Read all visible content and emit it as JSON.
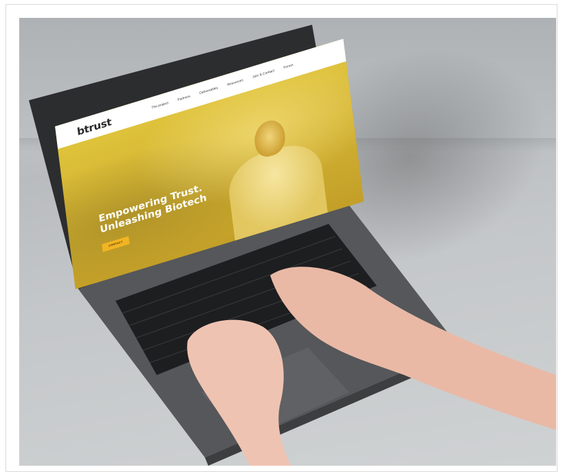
{
  "site": {
    "logo_text": "btrust",
    "nav_items": [
      {
        "label": "The project",
        "has_dropdown": true
      },
      {
        "label": "Partners",
        "has_dropdown": false
      },
      {
        "label": "Deliverables",
        "has_dropdown": false
      },
      {
        "label": "Resources",
        "has_dropdown": true
      },
      {
        "label": "Join & Contact",
        "has_dropdown": false
      },
      {
        "label": "Forum",
        "has_dropdown": false
      }
    ],
    "hero": {
      "title": "Empowering Trust.\nUnleashing Biotech",
      "button_label": "CONTACT"
    }
  },
  "colors": {
    "hero_overlay": "#d9c23a",
    "button": "#f2b423",
    "laptop_body": "#4a4b4d",
    "background": "#c4c7c9"
  },
  "icons": {
    "dropdown": "chevron-down-icon"
  }
}
